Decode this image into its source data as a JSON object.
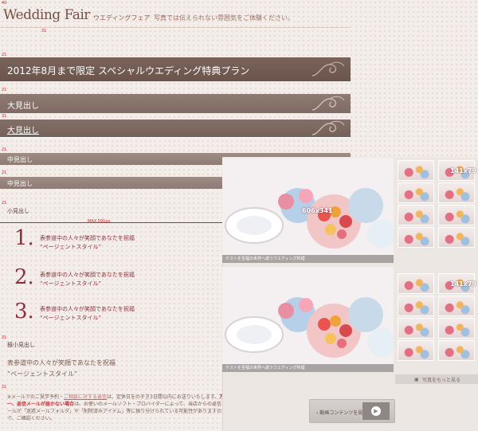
{
  "header": {
    "brand": "Wedding Fair",
    "brand_sub": "ウエディングフェア",
    "tagline": "写真では伝えられない雰囲気をご体験ください。"
  },
  "banners": {
    "title": "2012年8月まで限定 スペシャルウエディング特典プラン",
    "big_heading_1": "大見出し",
    "big_heading_2": "大見出し",
    "mid_heading_1": "中見出し",
    "mid_heading_2": "中見出し"
  },
  "guides": {
    "g40": "40",
    "g31a": "31",
    "g21a": "21",
    "g21b": "21",
    "g31b": "31",
    "g21c": "21",
    "g21d": "21",
    "g21e": "21",
    "g21f": "21",
    "g21g": "21",
    "max_width": "MAX 591px"
  },
  "small_heading": "小見出し",
  "numbered": [
    {
      "num": "1.",
      "line1": "表参道中の人々が笑顔であなたを祝福",
      "line2": "“ページェントスタイル”"
    },
    {
      "num": "2.",
      "line1": "表参道中の人々が笑顔であなたを祝福",
      "line2": "“ページェントスタイル”"
    },
    {
      "num": "3.",
      "line1": "表参道中の人々が笑顔であなたを祝福",
      "line2": "“ページェントスタイル”"
    }
  ],
  "xsmall_heading": "極小見出し",
  "plain": {
    "line1": "表参道中の人々が笑顔であなたを祝福",
    "line2": "“ページェントスタイル”"
  },
  "notice": {
    "p1": "※メールでのご見学予約・",
    "link": "ご相談に対する返信",
    "p2": "は、定休日をのぞき3日間以内にお送りいたします。",
    "strong": "万が一、返信メールが届かない場合",
    "p3": "は、お使いのメールソフト・プロバイダーによって、当店からの返信メールが「迷惑メールフォルダ」や「削除済みアイテム」等に振り分けられている可能性がありますので、ご確認ください。"
  },
  "gallery": {
    "photo_caption": "ゲストを至福の世界へ誘うウエディング料理",
    "main_size": "606x341",
    "thumb_size": "141x79",
    "more_label": "写真をもっと見る",
    "video_label": "› 動画コンテンツを見る"
  },
  "colors": {
    "accent": "#8c2f3a",
    "guide_red": "#d0202a",
    "banner_dark": "#6a544c",
    "banner_mid": "#8d7b74"
  },
  "icons": {
    "ornament": "flourish-ornament-icon",
    "more": "camera-icon",
    "play": "play-icon"
  }
}
